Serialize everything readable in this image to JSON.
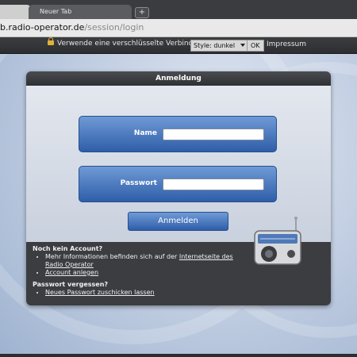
{
  "browser": {
    "tab_inactive_label": "Neuer Tab",
    "new_tab_label": "+",
    "url_host": "b.radio-operator.de",
    "url_path": "/session/login"
  },
  "site_header": {
    "secure_text": "Verwende eine verschlüsselte Verbindung",
    "style_select_value": "Style: dunkel",
    "ok_label": "OK",
    "impressum_label": "Impressum"
  },
  "login": {
    "title": "Anmeldung",
    "name_label": "Name",
    "name_value": "",
    "password_label": "Passwort",
    "password_value": "",
    "submit_label": "Anmelden"
  },
  "footer": {
    "no_account_title": "Noch kein Account?",
    "info_text": "Mehr Informationen befinden sich auf der",
    "info_link": "Internetseite des Radio Operator",
    "create_account_link": "Account anlegen",
    "forgot_title": "Passwort vergessen?",
    "reset_link": "Neues Passwort zuschicken lassen"
  },
  "colors": {
    "accent_blue": "#3a6cb8",
    "panel_dark": "#3b3d41",
    "header_dark": "#2c2e31"
  }
}
